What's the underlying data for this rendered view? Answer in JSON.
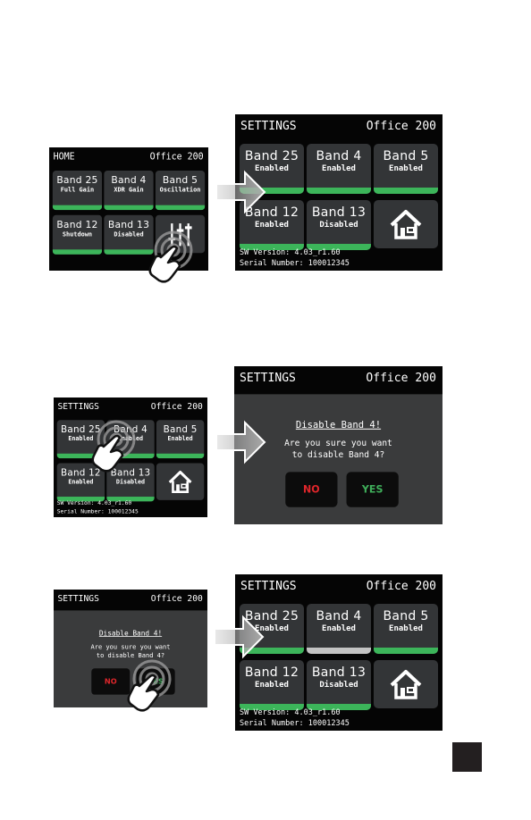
{
  "colors": {
    "enabled_bar": "#3cb55a",
    "disabled_bar": "#c3c3c3",
    "no": "#e0262b",
    "yes": "#3fae5a",
    "tile": "#333537"
  },
  "screens": [
    {
      "id": "home-small",
      "type": "grid",
      "title": "HOME",
      "location": "Office 200",
      "last_tile_icon": "sliders-icon",
      "tiles": [
        {
          "band": "Band 25",
          "status": "Full Gain",
          "bar": "enabled"
        },
        {
          "band": "Band 4",
          "status": "XDR Gain",
          "bar": "enabled"
        },
        {
          "band": "Band 5",
          "status": "Oscillation",
          "bar": "enabled"
        },
        {
          "band": "Band 12",
          "status": "Shutdown",
          "bar": "enabled"
        },
        {
          "band": "Band 13",
          "status": "Disabled",
          "bar": "enabled"
        }
      ]
    },
    {
      "id": "settings-large-1",
      "type": "grid",
      "title": "SETTINGS",
      "location": "Office 200",
      "last_tile_icon": "home-icon",
      "tiles": [
        {
          "band": "Band 25",
          "status": "Enabled",
          "bar": "enabled"
        },
        {
          "band": "Band 4",
          "status": "Enabled",
          "bar": "enabled"
        },
        {
          "band": "Band 5",
          "status": "Enabled",
          "bar": "enabled"
        },
        {
          "band": "Band 12",
          "status": "Enabled",
          "bar": "enabled"
        },
        {
          "band": "Band 13",
          "status": "Disabled",
          "bar": "enabled"
        }
      ],
      "sw_version": "SW Version: 4.03_r1.60",
      "serial": "Serial Number: 100012345"
    },
    {
      "id": "settings-small",
      "type": "grid",
      "title": "SETTINGS",
      "location": "Office 200",
      "last_tile_icon": "home-icon",
      "tiles": [
        {
          "band": "Band 25",
          "status": "Enabled",
          "bar": "enabled"
        },
        {
          "band": "Band 4",
          "status": "Enabled",
          "bar": "enabled"
        },
        {
          "band": "Band 5",
          "status": "Enabled",
          "bar": "enabled"
        },
        {
          "band": "Band 12",
          "status": "Enabled",
          "bar": "enabled"
        },
        {
          "band": "Band 13",
          "status": "Disabled",
          "bar": "enabled"
        }
      ],
      "sw_version": "SW Version: 4.03_r1.60",
      "serial": "Serial Number: 100012345"
    },
    {
      "id": "dialog-large",
      "type": "dialog",
      "title": "SETTINGS",
      "location": "Office 200",
      "heading": "Disable Band 4!",
      "question_line1": "Are you sure you want",
      "question_line2": "to disable Band 4?",
      "no_label": "NO",
      "yes_label": "YES"
    },
    {
      "id": "dialog-small",
      "type": "dialog",
      "title": "SETTINGS",
      "location": "Office 200",
      "heading": "Disable Band 4!",
      "question_line1": "Are you sure you want",
      "question_line2": "to disable Band 4?",
      "no_label": "NO",
      "yes_label": "YES"
    },
    {
      "id": "settings-large-2",
      "type": "grid",
      "title": "SETTINGS",
      "location": "Office 200",
      "last_tile_icon": "home-icon",
      "tiles": [
        {
          "band": "Band 25",
          "status": "Enabled",
          "bar": "enabled"
        },
        {
          "band": "Band 4",
          "status": "Enabled",
          "bar": "disabled"
        },
        {
          "band": "Band 5",
          "status": "Enabled",
          "bar": "enabled"
        },
        {
          "band": "Band 12",
          "status": "Enabled",
          "bar": "enabled"
        },
        {
          "band": "Band 13",
          "status": "Disabled",
          "bar": "enabled"
        }
      ],
      "sw_version": "SW Version: 4.03_r1.60",
      "serial": "Serial Number: 100012345"
    }
  ]
}
